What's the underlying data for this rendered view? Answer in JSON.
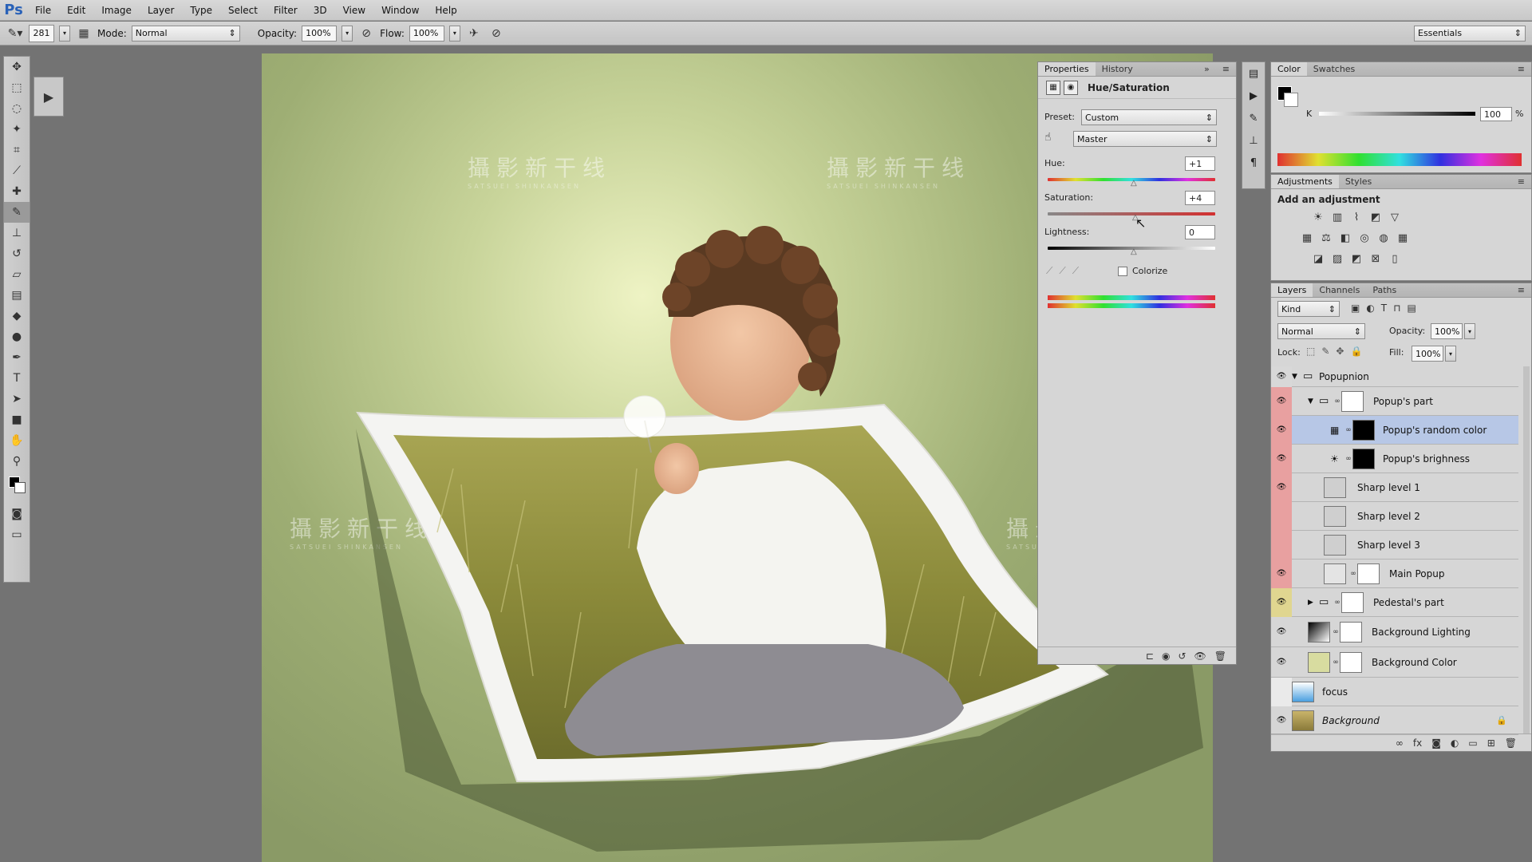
{
  "app": {
    "logo": "Ps"
  },
  "menu": [
    "File",
    "Edit",
    "Image",
    "Layer",
    "Type",
    "Select",
    "Filter",
    "3D",
    "View",
    "Window",
    "Help"
  ],
  "options": {
    "brush_size": "281",
    "mode_label": "Mode:",
    "mode_value": "Normal",
    "opacity_label": "Opacity:",
    "opacity_value": "100%",
    "flow_label": "Flow:",
    "flow_value": "100%",
    "workspace": "Essentials"
  },
  "watermark": {
    "text": "攝影新干线",
    "sub": "SATSUEI SHINKANSEN"
  },
  "properties": {
    "tabs": [
      "Properties",
      "History"
    ],
    "title": "Hue/Saturation",
    "preset_label": "Preset:",
    "preset_value": "Custom",
    "channel_value": "Master",
    "hue_label": "Hue:",
    "hue_value": "+1",
    "saturation_label": "Saturation:",
    "saturation_value": "+4",
    "lightness_label": "Lightness:",
    "lightness_value": "0",
    "colorize_label": "Colorize"
  },
  "color_panel": {
    "tabs": [
      "Color",
      "Swatches"
    ],
    "k_label": "K",
    "k_value": "100",
    "pct": "%"
  },
  "adjustments": {
    "tabs": [
      "Adjustments",
      "Styles"
    ],
    "heading": "Add an adjustment"
  },
  "layers_panel": {
    "tabs": [
      "Layers",
      "Channels",
      "Paths"
    ],
    "kind_label": "Kind",
    "blend_value": "Normal",
    "opacity_label": "Opacity:",
    "opacity_value": "100%",
    "lock_label": "Lock:",
    "fill_label": "Fill:",
    "fill_value": "100%",
    "layers": [
      {
        "name": "Popupnion"
      },
      {
        "name": "Popup's part"
      },
      {
        "name": "Popup's random color"
      },
      {
        "name": "Popup's brighness"
      },
      {
        "name": "Sharp level 1"
      },
      {
        "name": "Sharp level 2"
      },
      {
        "name": "Sharp level 3"
      },
      {
        "name": "Main Popup"
      },
      {
        "name": "Pedestal's part"
      },
      {
        "name": "Background Lighting"
      },
      {
        "name": "Background Color"
      },
      {
        "name": "focus"
      },
      {
        "name": "Background"
      }
    ]
  },
  "colors": {
    "accent": "#b7c7e6",
    "eye_red": "#e8a0a0",
    "eye_yellow": "#e0d690"
  }
}
